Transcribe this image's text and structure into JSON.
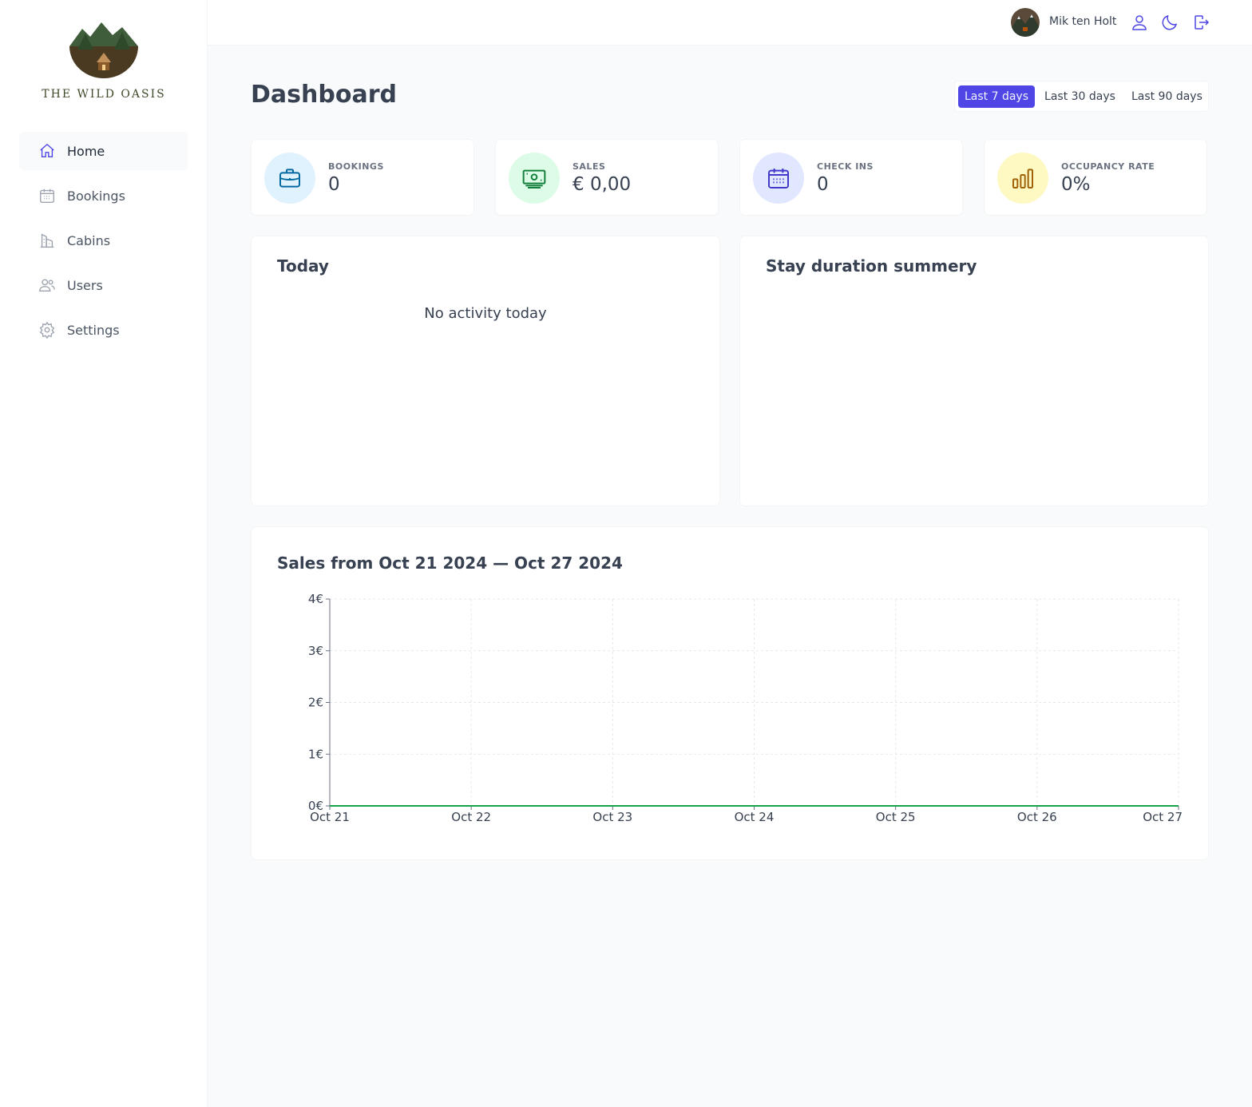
{
  "brand": {
    "name": "THE WILD OASIS"
  },
  "sidebar": {
    "items": [
      {
        "label": "Home",
        "icon": "home-icon",
        "active": true
      },
      {
        "label": "Bookings",
        "icon": "calendar-icon",
        "active": false
      },
      {
        "label": "Cabins",
        "icon": "building-icon",
        "active": false
      },
      {
        "label": "Users",
        "icon": "users-icon",
        "active": false
      },
      {
        "label": "Settings",
        "icon": "gear-icon",
        "active": false
      }
    ]
  },
  "header": {
    "user_name": "Mik ten Holt",
    "icons": [
      "user-icon",
      "moon-icon",
      "logout-icon"
    ]
  },
  "page": {
    "title": "Dashboard",
    "filters": [
      {
        "label": "Last 7 days",
        "active": true
      },
      {
        "label": "Last 30 days",
        "active": false
      },
      {
        "label": "Last 90 days",
        "active": false
      }
    ]
  },
  "stats": [
    {
      "label": "BOOKINGS",
      "value": "0",
      "icon": "briefcase-icon",
      "color": "#0369a1",
      "bg": "#e0f2fe"
    },
    {
      "label": "SALES",
      "value": "€ 0,00",
      "icon": "banknotes-icon",
      "color": "#15803d",
      "bg": "#dcfce7"
    },
    {
      "label": "CHECK INS",
      "value": "0",
      "icon": "calendar-days-icon",
      "color": "#4338ca",
      "bg": "#e0e7ff"
    },
    {
      "label": "OCCUPANCY RATE",
      "value": "0%",
      "icon": "chart-bar-icon",
      "color": "#a16207",
      "bg": "#fef9c3"
    }
  ],
  "today": {
    "title": "Today",
    "empty_message": "No activity today"
  },
  "duration": {
    "title": "Stay duration summery"
  },
  "sales": {
    "title": "Sales from Oct 21 2024 — Oct 27 2024"
  },
  "colors": {
    "accent": "#4f46e5",
    "line": "#16a34a"
  },
  "chart_data": {
    "type": "line",
    "title": "Sales from Oct 21 2024 — Oct 27 2024",
    "categories": [
      "Oct 21",
      "Oct 22",
      "Oct 23",
      "Oct 24",
      "Oct 25",
      "Oct 26",
      "Oct 27"
    ],
    "series": [
      {
        "values": [
          0,
          0,
          0,
          0,
          0,
          0,
          0
        ],
        "color": "#16a34a"
      }
    ],
    "y_ticks": [
      "0€",
      "1€",
      "2€",
      "3€",
      "4€"
    ],
    "ylim": [
      0,
      4
    ],
    "grid": true,
    "legend": "none"
  }
}
